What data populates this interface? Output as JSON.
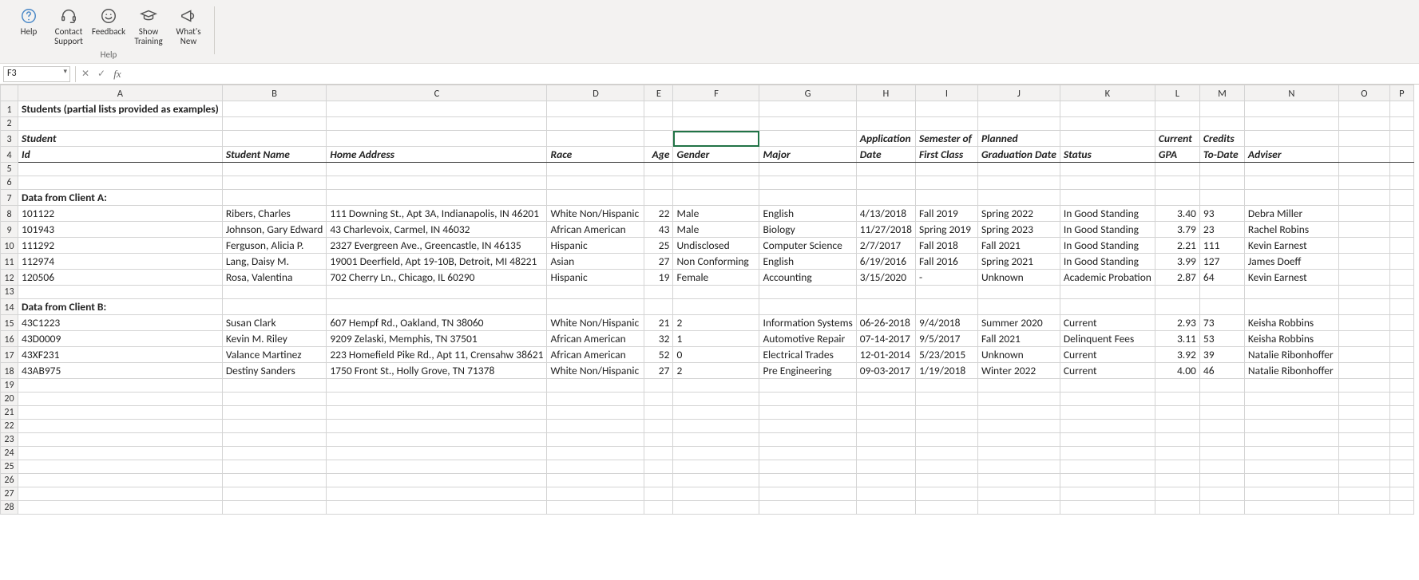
{
  "ribbon": {
    "group_label": "Help",
    "buttons": {
      "help": "Help",
      "contact": "Contact Support",
      "feedback": "Feedback",
      "training": "Show Training",
      "whatsnew": "What's New"
    }
  },
  "namebox": "F3",
  "formula": "",
  "columns": [
    "A",
    "B",
    "C",
    "D",
    "E",
    "F",
    "G",
    "H",
    "I",
    "J",
    "K",
    "L",
    "M",
    "N",
    "O",
    "P"
  ],
  "rows_count": 28,
  "title_row": "Students (partial lists provided as examples)",
  "headers": {
    "id": "Student Id",
    "name": "Student Name",
    "addr": "Home Address",
    "race": "Race",
    "age": "Age",
    "gender": "Gender",
    "major": "Major",
    "app_top": "Application",
    "app_bot": "Date",
    "sem_top": "Semester of",
    "sem_bot": "First Class",
    "plan_top": "Planned",
    "plan_bot": "Graduation Date",
    "status": "Status",
    "gpa_top": "Current",
    "gpa_bot": "GPA",
    "cred_top": "Credits",
    "cred_bot": "To-Date",
    "adviser": "Adviser"
  },
  "section_a": "Data from Client A:",
  "section_b": "Data from Client B:",
  "client_a": [
    {
      "id": "101122",
      "name": "Ribers, Charles",
      "addr": "111 Downing St., Apt 3A, Indianapolis, IN  46201",
      "race": "White Non/Hispanic",
      "age": "22",
      "gender": "Male",
      "major": "English",
      "app": "4/13/2018",
      "sem": "Fall 2019",
      "plan": "Spring 2022",
      "status": "In Good Standing",
      "gpa": "3.40",
      "cred": "93",
      "adviser": "Debra Miller"
    },
    {
      "id": "101943",
      "name": "Johnson, Gary Edward",
      "addr": "43 Charlevoix, Carmel, IN  46032",
      "race": "African American",
      "age": "43",
      "gender": "Male",
      "major": "Biology",
      "app": "11/27/2018",
      "sem": "Spring 2019",
      "plan": "Spring 2023",
      "status": "In Good Standing",
      "gpa": "3.79",
      "cred": "23",
      "adviser": "Rachel Robins"
    },
    {
      "id": "111292",
      "name": "Ferguson, Alicia P.",
      "addr": "2327 Evergreen Ave., Greencastle, IN  46135",
      "race": "Hispanic",
      "age": "25",
      "gender": "Undisclosed",
      "major": "Computer Science",
      "app": "2/7/2017",
      "sem": "Fall 2018",
      "plan": "Fall 2021",
      "status": "In Good Standing",
      "gpa": "2.21",
      "cred": "111",
      "adviser": "Kevin Earnest"
    },
    {
      "id": "112974",
      "name": "Lang, Daisy M.",
      "addr": "19001 Deerfield, Apt 19-10B, Detroit, MI  48221",
      "race": "Asian",
      "age": "27",
      "gender": "Non Conforming",
      "major": "English",
      "app": "6/19/2016",
      "sem": "Fall 2016",
      "plan": "Spring 2021",
      "status": "In Good Standing",
      "gpa": "3.99",
      "cred": "127",
      "adviser": "James Doeff"
    },
    {
      "id": "120506",
      "name": "Rosa, Valentina",
      "addr": "702 Cherry Ln., Chicago, IL  60290",
      "race": "Hispanic",
      "age": "19",
      "gender": "Female",
      "major": "Accounting",
      "app": "3/15/2020",
      "sem": "-",
      "plan": "Unknown",
      "status": "Academic Probation",
      "gpa": "2.87",
      "cred": "64",
      "adviser": "Kevin Earnest"
    }
  ],
  "client_b": [
    {
      "id": "43C1223",
      "name": "Susan Clark",
      "addr": "607 Hempf Rd., Oakland, TN  38060",
      "race": "White Non/Hispanic",
      "age": "21",
      "gender": "2",
      "major": "Information Systems",
      "app": "06-26-2018",
      "sem": "9/4/2018",
      "plan": "Summer 2020",
      "status": "Current",
      "gpa": "2.93",
      "cred": "73",
      "adviser": "Keisha Robbins"
    },
    {
      "id": "43D0009",
      "name": "Kevin M. Riley",
      "addr": "9209 Zelaski, Memphis, TN  37501",
      "race": "African American",
      "age": "32",
      "gender": "1",
      "major": "Automotive Repair",
      "app": "07-14-2017",
      "sem": "9/5/2017",
      "plan": "Fall 2021",
      "status": "Delinquent Fees",
      "gpa": "3.11",
      "cred": "53",
      "adviser": "Keisha Robbins"
    },
    {
      "id": "43XF231",
      "name": "Valance Martinez",
      "addr": "223 Homefield Pike Rd., Apt 11, Crensahw  38621",
      "race": "African American",
      "age": "52",
      "gender": "0",
      "major": "Electrical Trades",
      "app": "12-01-2014",
      "sem": "5/23/2015",
      "plan": "Unknown",
      "status": "Current",
      "gpa": "3.92",
      "cred": "39",
      "adviser": "Natalie Ribonhoffer"
    },
    {
      "id": "43AB975",
      "name": "Destiny Sanders",
      "addr": "1750 Front St., Holly Grove, TN  71378",
      "race": "White Non/Hispanic",
      "age": "27",
      "gender": "2",
      "major": "Pre Engineering",
      "app": "09-03-2017",
      "sem": "1/19/2018",
      "plan": "Winter 2022",
      "status": "Current",
      "gpa": "4.00",
      "cred": "46",
      "adviser": "Natalie Ribonhoffer"
    }
  ]
}
